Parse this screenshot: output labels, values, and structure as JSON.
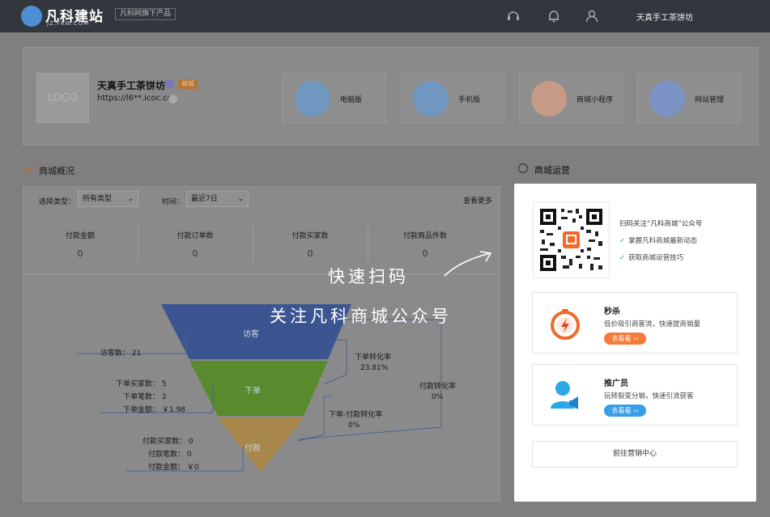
{
  "header": {
    "logo_text": "凡科建站",
    "logo_sub": "JZ.FKW.COM",
    "product_tag": "凡科网旗下产品",
    "icons": [
      "headset-icon",
      "bell-icon",
      "user-icon"
    ],
    "username": "天真手工茶饼坊"
  },
  "store": {
    "logo_placeholder": "LOGO",
    "name": "天真手工茶饼坊",
    "badge": "商城",
    "url": "https://l6**.icoc.cc",
    "tiles": [
      {
        "label": "电脑版",
        "icon": "desktop-icon",
        "color": "#6f97c0"
      },
      {
        "label": "手机版",
        "icon": "mobile-icon",
        "color": "#6f97c0"
      },
      {
        "label": "商城小程序",
        "icon": "mini-program-icon",
        "color": "#c59a86"
      },
      {
        "label": "网站管理",
        "icon": "site-manage-icon",
        "color": "#7b93c4"
      }
    ]
  },
  "overview": {
    "title": "商城概况",
    "filter_type_label": "选择类型：",
    "filter_type_value": "所有类型",
    "filter_time_label": "时间：",
    "filter_time_value": "最近7日",
    "more_link": "查看更多",
    "stats": [
      {
        "label": "付款金额",
        "value": "0"
      },
      {
        "label": "付款订单数",
        "value": "0"
      },
      {
        "label": "付款买家数",
        "value": "0"
      },
      {
        "label": "付款商品件数",
        "value": "0"
      }
    ],
    "funnel": {
      "stages": [
        {
          "label": "访客",
          "color": "#3a558f"
        },
        {
          "label": "下单",
          "color": "#5a8a2e"
        },
        {
          "label": "付款",
          "color": "#a8884a"
        }
      ],
      "visitors": "访客数： 21",
      "order_buyers": "下单买家数： 5",
      "order_count": "下单笔数： 2",
      "order_amount": "下单金额： ￥1.98",
      "pay_buyers": "付款买家数： 0",
      "pay_count": "付款笔数： 0",
      "pay_amount": "付款金额： ￥0",
      "order_conv_label": "下单转化率",
      "order_conv_value": "23.81%",
      "pay_conv_label": "付款转化率",
      "pay_conv_value": "0%",
      "order_pay_conv_label": "下单-付款转化率",
      "order_pay_conv_value": "0%"
    }
  },
  "operations": {
    "title": "商城运营",
    "qr_heading": "扫码关注“凡科商城”公众号",
    "checks": [
      "掌握凡科商城最新动态",
      "获取商城运营技巧"
    ],
    "promos": [
      {
        "title": "秒杀",
        "desc": "低价吸引商客流，快速提商销量",
        "button": "去看看 ››",
        "button_color": "#f47b3b",
        "icon": "stopwatch-icon"
      },
      {
        "title": "推广员",
        "desc": "玩转裂变分销，快速引流获客",
        "button": "去看看 ››",
        "button_color": "#3a9de8",
        "icon": "promoter-icon"
      }
    ],
    "cta": "前往营销中心"
  },
  "overlay": {
    "line1": "快速扫码",
    "line2": "关注凡科商城公众号"
  }
}
